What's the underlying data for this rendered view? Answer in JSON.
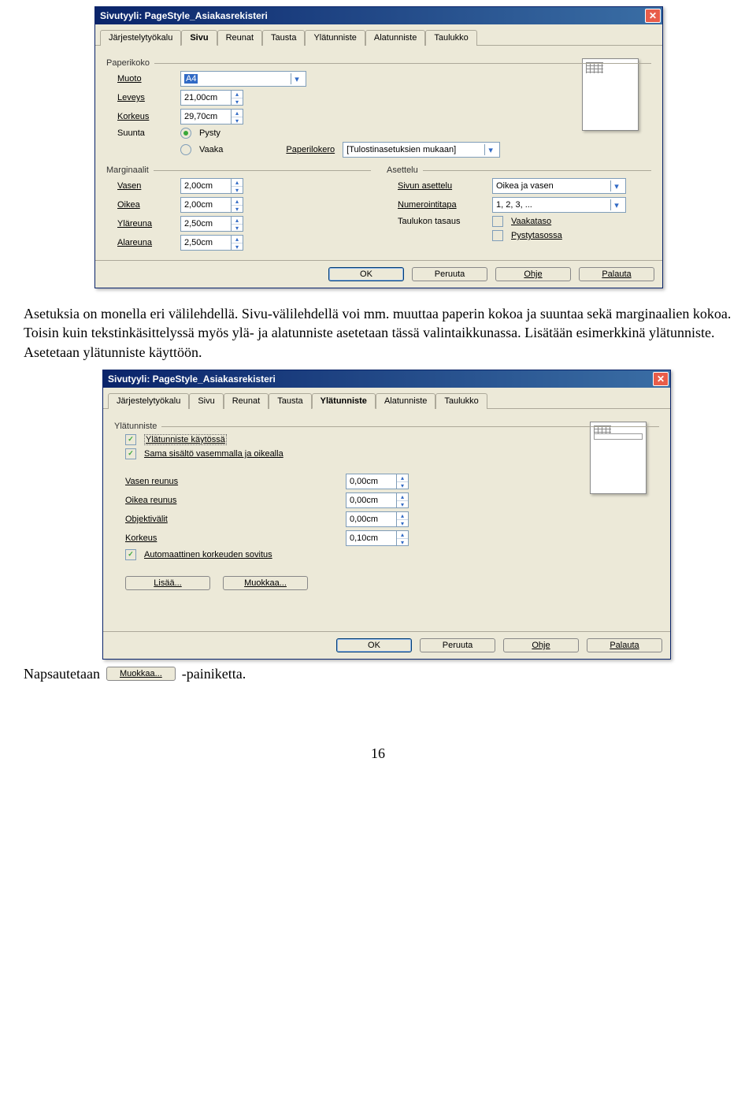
{
  "dialog1": {
    "title": "Sivutyyli: PageStyle_Asiakasrekisteri",
    "tabs": [
      "Järjestelytyökalu",
      "Sivu",
      "Reunat",
      "Tausta",
      "Ylätunniste",
      "Alatunniste",
      "Taulukko"
    ],
    "active_tab": "Sivu",
    "group_paperikoko": "Paperikoko",
    "muoto_lbl": "Muoto",
    "muoto_val": "A4",
    "leveys_lbl": "Leveys",
    "leveys_val": "21,00cm",
    "korkeus_lbl": "Korkeus",
    "korkeus_val": "29,70cm",
    "suunta_lbl": "Suunta",
    "pysty": "Pysty",
    "vaaka": "Vaaka",
    "paperilokero_lbl": "Paperilokero",
    "paperilokero_val": "[Tulostinasetuksien mukaan]",
    "group_marginaalit": "Marginaalit",
    "vasen_lbl": "Vasen",
    "vasen_val": "2,00cm",
    "oikea_lbl": "Oikea",
    "oikea_val": "2,00cm",
    "ylareuna_lbl": "Yläreuna",
    "ylareuna_val": "2,50cm",
    "alareuna_lbl": "Alareuna",
    "alareuna_val": "2,50cm",
    "group_asettelu": "Asettelu",
    "sivun_asettelu_lbl": "Sivun asettelu",
    "sivun_asettelu_val": "Oikea ja vasen",
    "numerointi_lbl": "Numerointitapa",
    "numerointi_val": "1, 2, 3, ...",
    "taulukon_tasaus_lbl": "Taulukon tasaus",
    "vaakataso": "Vaakataso",
    "pystytasossa": "Pystytasossa",
    "buttons": {
      "ok": "OK",
      "peruuta": "Peruuta",
      "ohje": "Ohje",
      "palauta": "Palauta"
    }
  },
  "para1": "Asetuksia on monella eri välilehdellä. Sivu-välilehdellä voi mm. muuttaa paperin kokoa ja suuntaa sekä marginaalien kokoa. Toisin kuin tekstinkäsittelyssä myös ylä- ja alatunniste asetetaan tässä valintaikkunassa. Lisätään esimerkkinä ylätunniste. Asetetaan ylätunniste käyttöön.",
  "dialog2": {
    "title": "Sivutyyli: PageStyle_Asiakasrekisteri",
    "tabs": [
      "Järjestelytyökalu",
      "Sivu",
      "Reunat",
      "Tausta",
      "Ylätunniste",
      "Alatunniste",
      "Taulukko"
    ],
    "active_tab": "Ylätunniste",
    "group": "Ylätunniste",
    "chk_kaytossa": "Ylätunniste käytössä",
    "chk_sama": "Sama sisältö vasemmalla ja oikealla",
    "vasen_reunus_lbl": "Vasen reunus",
    "vasen_reunus_val": "0,00cm",
    "oikea_reunus_lbl": "Oikea reunus",
    "oikea_reunus_val": "0,00cm",
    "objektivalit_lbl": "Objektivälit",
    "objektivalit_val": "0,00cm",
    "korkeus_lbl": "Korkeus",
    "korkeus_val": "0,10cm",
    "chk_auto": "Automaattinen korkeuden sovitus",
    "lisaa_btn": "Lisää...",
    "muokkaa_btn": "Muokkaa...",
    "buttons": {
      "ok": "OK",
      "peruuta": "Peruuta",
      "ohje": "Ohje",
      "palauta": "Palauta"
    }
  },
  "inline": {
    "pre": "Napsautetaan",
    "btn": "Muokkaa...",
    "post": "-painiketta."
  },
  "pagenum": "16"
}
